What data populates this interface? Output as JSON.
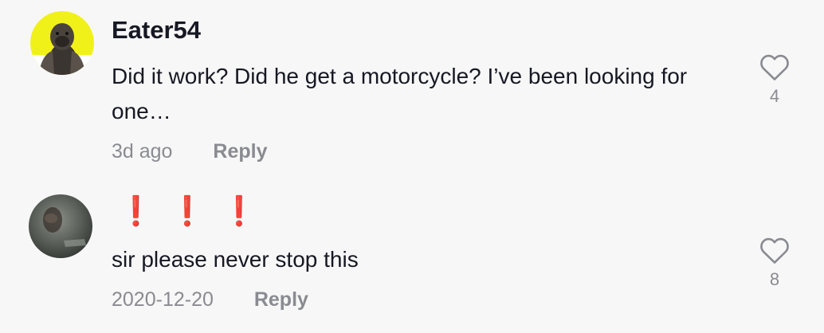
{
  "comments": [
    {
      "username": "Eater54",
      "text": "Did it work? Did he get a motorcycle? I’ve been looking for one…",
      "timestamp": "3d ago",
      "reply_label": "Reply",
      "likes": "4",
      "icon": "heart-outline-icon"
    },
    {
      "emoji": "❗❗❗",
      "text": "sir please never stop this",
      "timestamp": "2020-12-20",
      "reply_label": "Reply",
      "likes": "8",
      "icon": "heart-outline-icon"
    }
  ],
  "colors": {
    "background": "#f7f7f7",
    "text": "#161823",
    "muted": "#8a8b91",
    "exclamation": "#e8231f",
    "avatar1_bg": "#f1f11a"
  }
}
